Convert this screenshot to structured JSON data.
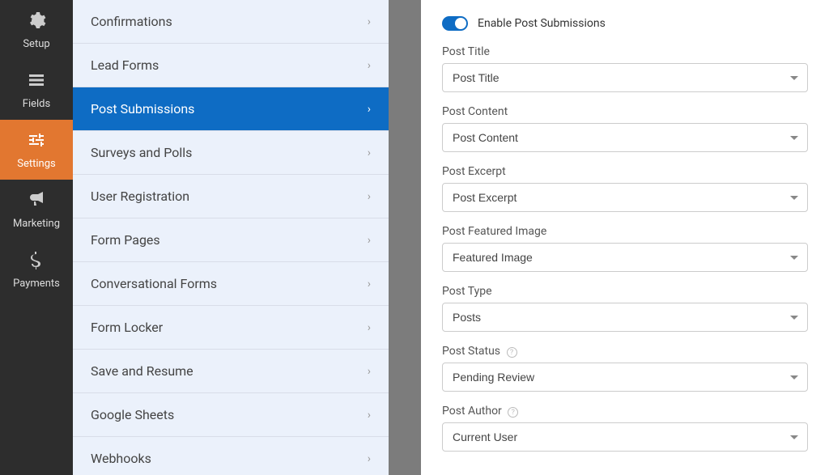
{
  "nav": [
    {
      "label": "Setup",
      "icon": "gear"
    },
    {
      "label": "Fields",
      "icon": "list"
    },
    {
      "label": "Settings",
      "icon": "sliders",
      "active": true
    },
    {
      "label": "Marketing",
      "icon": "bullhorn"
    },
    {
      "label": "Payments",
      "icon": "dollar"
    }
  ],
  "menu": [
    {
      "label": "Confirmations"
    },
    {
      "label": "Lead Forms"
    },
    {
      "label": "Post Submissions",
      "selected": true
    },
    {
      "label": "Surveys and Polls"
    },
    {
      "label": "User Registration"
    },
    {
      "label": "Form Pages"
    },
    {
      "label": "Conversational Forms"
    },
    {
      "label": "Form Locker"
    },
    {
      "label": "Save and Resume"
    },
    {
      "label": "Google Sheets"
    },
    {
      "label": "Webhooks"
    }
  ],
  "form": {
    "enable_label": "Enable Post Submissions",
    "fields": [
      {
        "label": "Post Title",
        "value": "Post Title",
        "help": false
      },
      {
        "label": "Post Content",
        "value": "Post Content",
        "help": false
      },
      {
        "label": "Post Excerpt",
        "value": "Post Excerpt",
        "help": false
      },
      {
        "label": "Post Featured Image",
        "value": "Featured Image",
        "help": false
      },
      {
        "label": "Post Type",
        "value": "Posts",
        "help": false
      },
      {
        "label": "Post Status",
        "value": "Pending Review",
        "help": true
      },
      {
        "label": "Post Author",
        "value": "Current User",
        "help": true
      }
    ]
  }
}
